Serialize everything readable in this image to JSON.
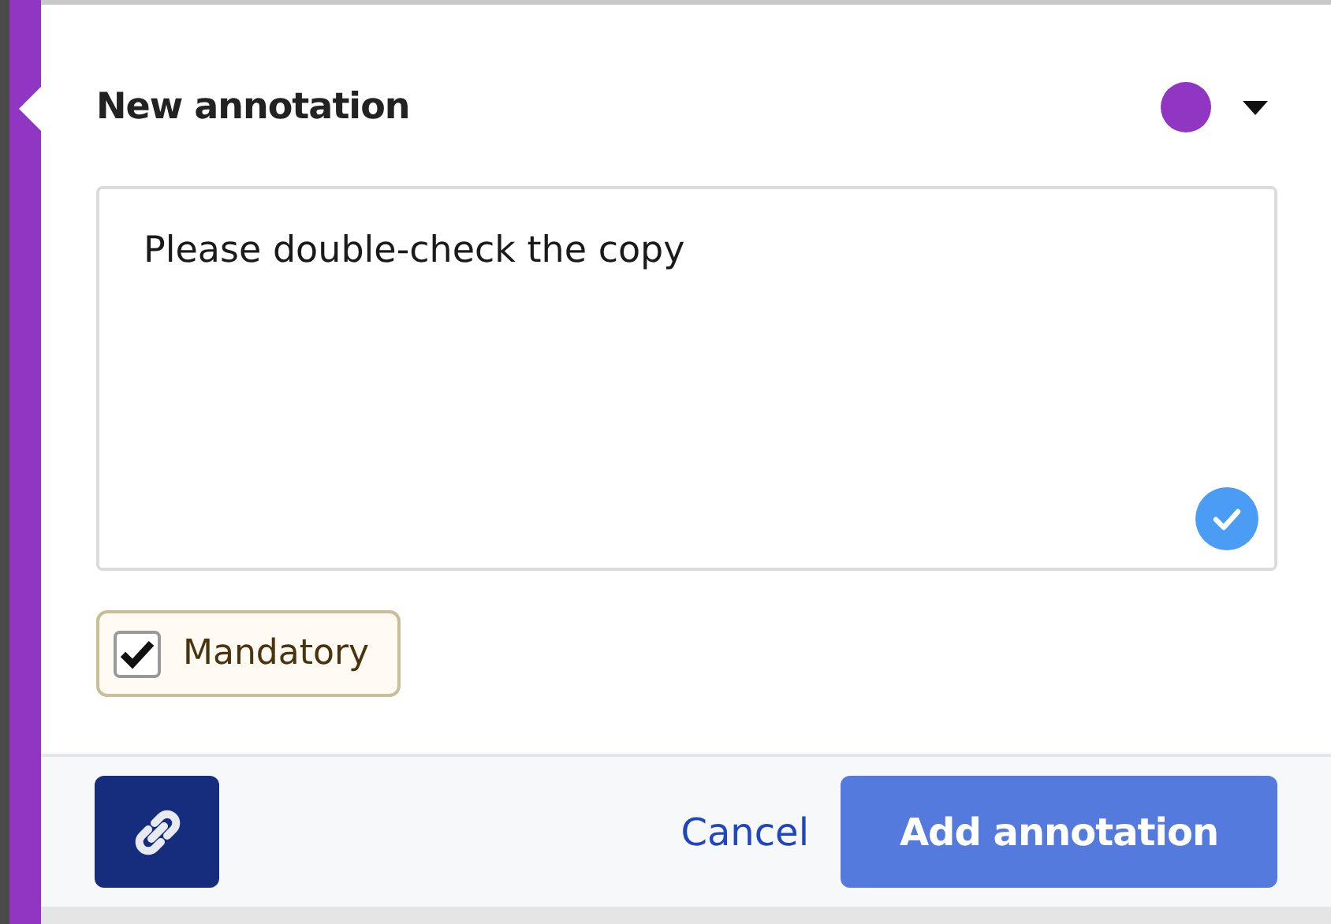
{
  "title": "New annotation",
  "color": "#9036c2",
  "text": "Please double-check the copy",
  "mandatory": {
    "label": "Mandatory",
    "checked": true
  },
  "footer": {
    "cancel": "Cancel",
    "submit": "Add annotation"
  }
}
